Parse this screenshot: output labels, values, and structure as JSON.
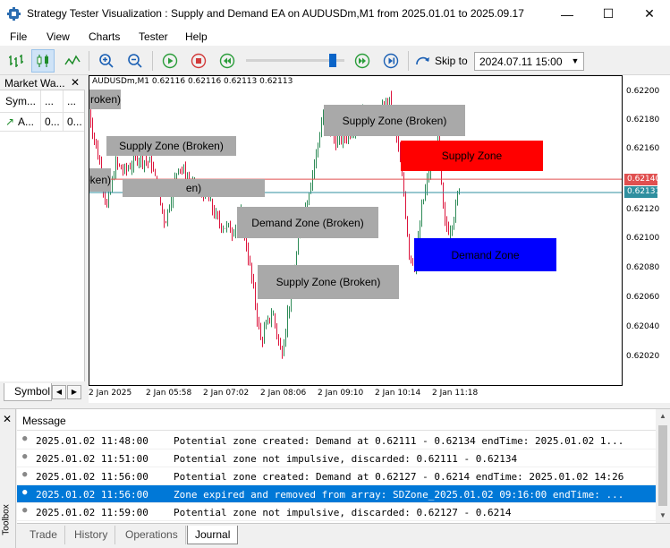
{
  "window": {
    "title": "Strategy Tester Visualization : Supply and Demand EA on AUDUSDm,M1 from 2025.01.01 to 2025.09.17",
    "minimize": "—",
    "maximize": "☐",
    "close": "✕"
  },
  "menu": [
    "File",
    "View",
    "Charts",
    "Tester",
    "Help"
  ],
  "toolbar": {
    "icons": [
      "bar-chart-icon",
      "candlestick-icon",
      "line-chart-icon",
      "zoom-in-icon",
      "zoom-out-icon",
      "play-icon",
      "stop-icon",
      "slower-icon",
      "faster-icon",
      "step-forward-icon",
      "skip-icon"
    ],
    "speed": 0.88,
    "skip_label": "Skip to",
    "skip_date": "2024.07.11 15:00"
  },
  "market_watch": {
    "title": "Market Wa...",
    "close": "✕",
    "columns": [
      "Sym...",
      "...",
      "..."
    ],
    "rows": [
      {
        "arrow": "↗",
        "symbol": "A...",
        "bid": "0...",
        "ask": "0..."
      }
    ],
    "tab": "Symbol",
    "accent": "#1e8c2a"
  },
  "chart": {
    "symbol_info": "AUDUSDm,M1  0.62116 0.62116 0.62113 0.62113",
    "price_labels": [
      "0.62200",
      "0.62180",
      "0.62160",
      "0.62120",
      "0.62100",
      "0.62080",
      "0.62060",
      "0.62040",
      "0.62020"
    ],
    "bid_tag": "0.62140",
    "ask_tag": "0.62131",
    "bid_color": "#e05050",
    "ask_color": "#2f8f9f",
    "time_labels": [
      "2 Jan 2025",
      "2 Jan 05:58",
      "2 Jan 07:02",
      "2 Jan 08:06",
      "2 Jan 09:10",
      "2 Jan 10:14",
      "2 Jan 11:18"
    ],
    "zones": [
      {
        "label": "roken)",
        "type": "broken"
      },
      {
        "label": "Supply Zone (Broken)",
        "type": "broken"
      },
      {
        "label": "Supply Zone (Broken)",
        "type": "broken"
      },
      {
        "label": "en)",
        "type": "broken"
      },
      {
        "label": "Demand Zone (Broken)",
        "type": "broken"
      },
      {
        "label": "Supply Zone (Broken)",
        "type": "broken"
      },
      {
        "label": "Supply Zone (Broken)",
        "type": "broken"
      },
      {
        "label": "Supply Zone",
        "type": "supply"
      },
      {
        "label": "Demand Zone",
        "type": "demand"
      }
    ],
    "colors": {
      "broken": "#a9a9a9",
      "supply": "#ff0000",
      "demand": "#0000ff",
      "bull": "#2e8b57",
      "bear": "#dc143c"
    }
  },
  "toolbox": {
    "side_label": "Toolbox",
    "close": "✕",
    "header": "Message",
    "logs": [
      {
        "time": "2025.01.02 11:48:00",
        "msg": "Potential zone created: Demand at 0.62111 - 0.62134 endTime: 2025.01.02 1..."
      },
      {
        "time": "2025.01.02 11:51:00",
        "msg": "Potential zone not impulsive, discarded: 0.62111 - 0.62134"
      },
      {
        "time": "2025.01.02 11:56:00",
        "msg": "Potential zone created: Demand at 0.62127 - 0.6214 endTime: 2025.01.02 14:26"
      },
      {
        "time": "2025.01.02 11:56:00",
        "msg": "Zone expired and removed from array: SDZone_2025.01.02 09:16:00 endTime: ...",
        "selected": true
      },
      {
        "time": "2025.01.02 11:59:00",
        "msg": "Potential zone not impulsive, discarded: 0.62127 - 0.6214"
      }
    ],
    "tabs": [
      "Trade",
      "History",
      "Operations",
      "Journal"
    ],
    "active_tab": "Journal"
  }
}
